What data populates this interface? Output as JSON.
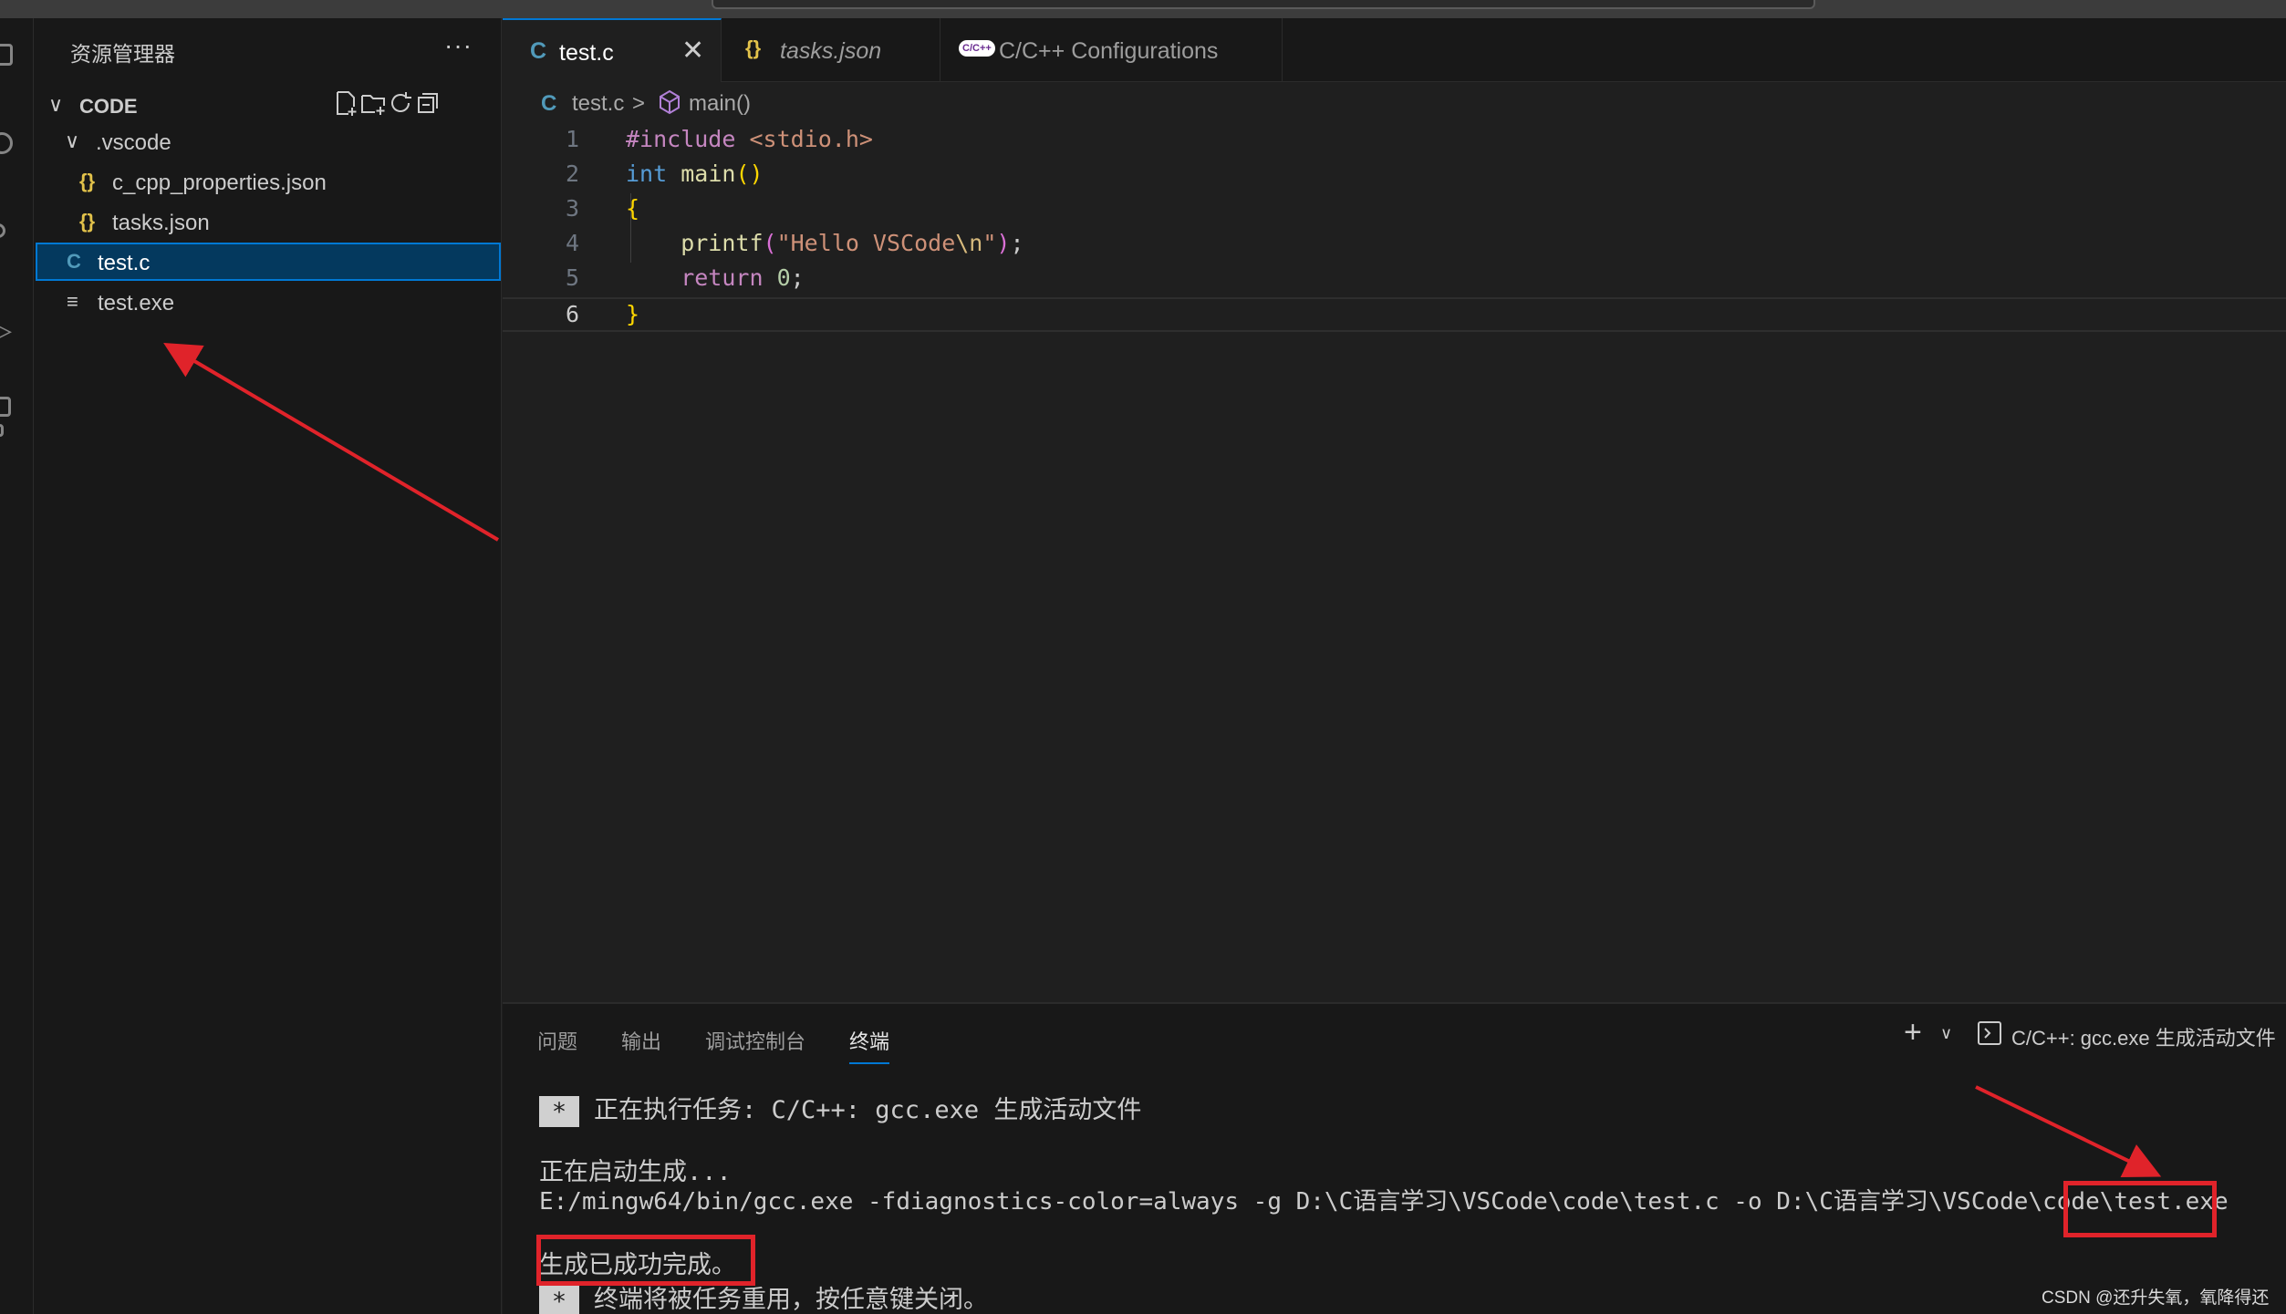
{
  "sidebar": {
    "title": "资源管理器",
    "more": "···",
    "section_label": "CODE",
    "tree": [
      {
        "name": ".vscode",
        "icon": "chevron-down-icon",
        "glyph": "∨"
      },
      {
        "name": "c_cpp_properties.json",
        "icon": "json-file-icon",
        "glyph": "{}"
      },
      {
        "name": "tasks.json",
        "icon": "json-file-icon",
        "glyph": "{}"
      },
      {
        "name": "test.c",
        "icon": "c-file-icon",
        "glyph": "C",
        "selected": true
      },
      {
        "name": "test.exe",
        "icon": "text-file-icon",
        "glyph": "≡"
      }
    ]
  },
  "tabs": [
    {
      "label": "test.c",
      "glyph": "C",
      "close": "✕",
      "active": true
    },
    {
      "label": "tasks.json",
      "glyph": "{}"
    },
    {
      "label": "C/C++ Configurations",
      "glyph": "C/C++"
    }
  ],
  "breadcrumb": {
    "file_glyph": "C",
    "file": "test.c",
    "separator": ">",
    "symbol": "main()"
  },
  "editor": {
    "lines": [
      {
        "num": "1",
        "tokens": [
          {
            "t": "#include ",
            "c": "#c586c0"
          },
          {
            "t": "<stdio.h>",
            "c": "#ce9178"
          }
        ]
      },
      {
        "num": "2",
        "tokens": [
          {
            "t": "int ",
            "c": "#569cd6"
          },
          {
            "t": "main",
            "c": "#dcdcaa"
          },
          {
            "t": "()",
            "c": "#ffd700"
          }
        ]
      },
      {
        "num": "3",
        "tokens": [
          {
            "t": "{",
            "c": "#ffd700"
          }
        ]
      },
      {
        "num": "4",
        "tokens": [
          {
            "t": "    printf",
            "c": "#dcdcaa"
          },
          {
            "t": "(",
            "c": "#da70d6"
          },
          {
            "t": "\"Hello VSCode",
            "c": "#ce9178"
          },
          {
            "t": "\\n",
            "c": "#d7ba7d"
          },
          {
            "t": "\"",
            "c": "#ce9178"
          },
          {
            "t": ")",
            "c": "#da70d6"
          },
          {
            "t": ";",
            "c": "#cccccc"
          }
        ]
      },
      {
        "num": "5",
        "tokens": [
          {
            "t": "    return ",
            "c": "#c586c0"
          },
          {
            "t": "0",
            "c": "#b5cea8"
          },
          {
            "t": ";",
            "c": "#cccccc"
          }
        ]
      },
      {
        "num": "6",
        "tokens": [
          {
            "t": "}",
            "c": "#ffd700"
          }
        ],
        "current": true
      }
    ]
  },
  "panel": {
    "tabs": [
      "问题",
      "输出",
      "调试控制台",
      "终端"
    ],
    "active_tab": "终端",
    "add": "+",
    "dropdown": "∨",
    "task_label": "C/C++: gcc.exe 生成活动文件",
    "terminal": {
      "star": "*",
      "task_line": "正在执行任务: C/C++: gcc.exe 生成活动文件",
      "start_line": "正在启动生成...",
      "command": "E:/mingw64/bin/gcc.exe -fdiagnostics-color=always -g D:\\C语言学习\\VSCode\\code\\test.c -o D:\\C语言学习\\VSCode\\code\\test.exe",
      "success": "生成已成功完成。",
      "reuse": "终端将被任务重用，按任意键关闭。"
    }
  },
  "watermark": "CSDN @还升失氧，氧降得还",
  "colors": {
    "accent": "#0078d4",
    "annotation_red": "#e0232a",
    "json_icon": "#e2c24a",
    "c_icon": "#519aba"
  }
}
